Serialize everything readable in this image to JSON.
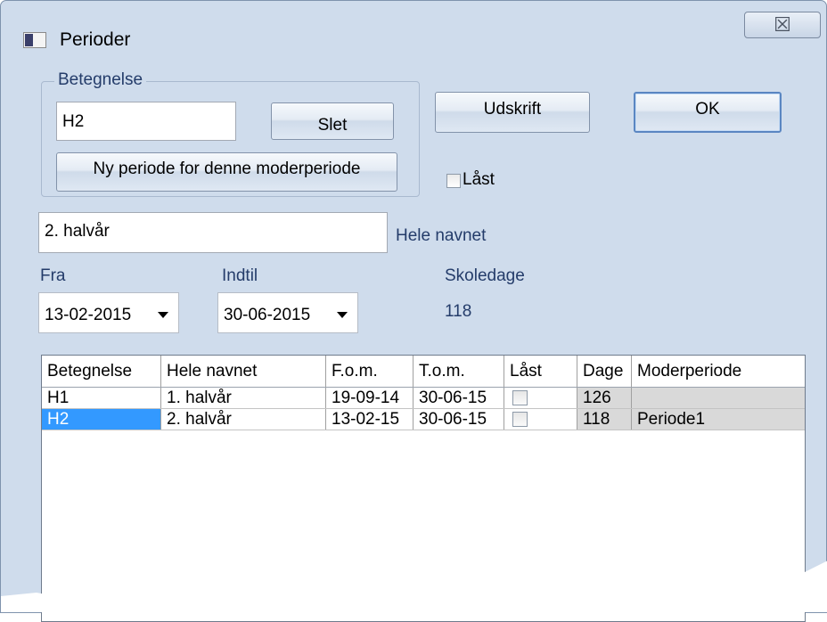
{
  "window": {
    "title": "Perioder",
    "close_glyph": "☒"
  },
  "group": {
    "legend": "Betegnelse",
    "name_value": "H2",
    "delete_label": "Slet",
    "new_period_label": "Ny periode for denne moderperiode"
  },
  "actions": {
    "print_label": "Udskrift",
    "ok_label": "OK"
  },
  "locked": {
    "label": "Låst",
    "checked": false
  },
  "full_name": {
    "value": "2. halvår",
    "label": "Hele navnet"
  },
  "dates": {
    "from_label": "Fra",
    "from_value": "13-02-2015",
    "to_label": "Indtil",
    "to_value": "30-06-2015"
  },
  "school_days": {
    "label": "Skoledage",
    "value": "118"
  },
  "table": {
    "columns": [
      "Betegnelse",
      "Hele navnet",
      "F.o.m.",
      "T.o.m.",
      "Låst",
      "Dage",
      "Moderperiode"
    ],
    "rows": [
      {
        "name": "H1",
        "full_name": "1. halvår",
        "from": "19-09-14",
        "to": "30-06-15",
        "locked": false,
        "days": "126",
        "parent": ""
      },
      {
        "name": "H2",
        "full_name": "2. halvår",
        "from": "13-02-15",
        "to": "30-06-15",
        "locked": false,
        "days": "118",
        "parent": "Periode1",
        "selected": true
      }
    ]
  },
  "colors": {
    "window_bg": "#cfdcec",
    "label_blue": "#243c6a",
    "selection": "#3399ff",
    "readonly_cell": "#d9d9d9"
  }
}
